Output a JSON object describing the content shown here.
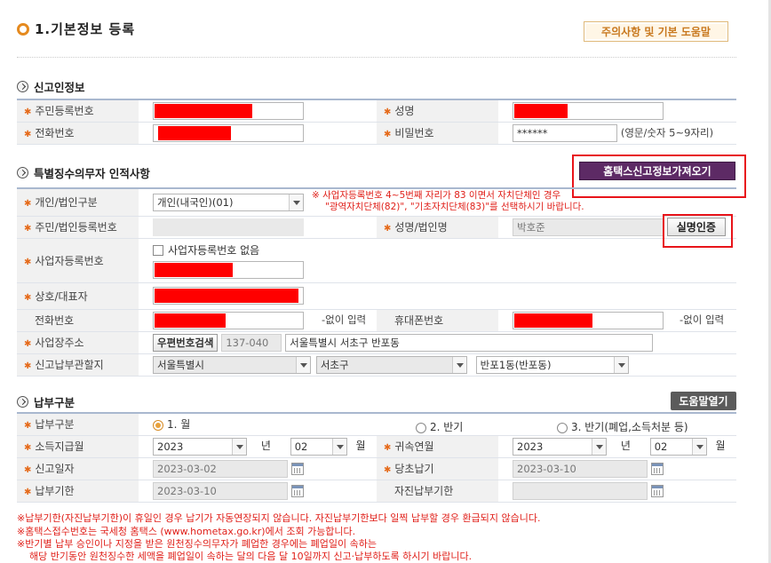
{
  "page": {
    "title": "1.기본정보 등록",
    "help_button": "주의사항 및 기본 도움말"
  },
  "reporter": {
    "section_title": "신고인정보",
    "labels": {
      "rrn": "주민등록번호",
      "name": "성명",
      "phone": "전화번호",
      "password": "비밀번호"
    },
    "password_value": "******",
    "password_hint": "(영문/숫자 5~9자리)"
  },
  "withholder": {
    "section_title": "특별징수의무자 인적사항",
    "hometax_button": "홈택스신고정보가져오기",
    "labels": {
      "type": "개인/법인구분",
      "id_no": "주민/법인등록번호",
      "name": "성명/법인명",
      "biz_no": "사업자등록번호",
      "company": "상호/대표자",
      "phone": "전화번호",
      "mobile": "휴대폰번호",
      "address": "사업장주소",
      "jurisdiction": "신고납부관할지"
    },
    "type_value": "개인(내국인)(01)",
    "notice_line1": "※ 사업자등록번호 4~5번째 자리가 83 이면서 자치단체인 경우",
    "notice_line2": "\"광역자치단체(82)\", \"기초자치단체(83)\"를 선택하시기 바랍니다.",
    "name_value": "박호준",
    "verify_button": "실명인증",
    "no_biz_checkbox": "사업자등록번호 없음",
    "no_input_phone": "-없이 입력",
    "no_input_mobile": "-없이 입력",
    "zip_button": "우편번호검색",
    "zip_value": "137-040",
    "address_value": "서울특별시 서초구 반포동",
    "city_value": "서울특별시",
    "district_value": "서초구",
    "dong_value": "반포1동(반포동)"
  },
  "payment": {
    "section_title": "납부구분",
    "help_button": "도움말열기",
    "labels": {
      "type": "납부구분",
      "pay_month": "소득지급월",
      "attr_month": "귀속연월",
      "report_date": "신고일자",
      "due_date": "당초납기",
      "deadline": "납부기한",
      "self_deadline": "자진납부기한"
    },
    "radio_1": "1. 월",
    "radio_2": "2. 반기",
    "radio_3": "3. 반기(폐업,소득처분 등)",
    "pay_year": "2023",
    "pay_month": "02",
    "attr_year": "2023",
    "attr_month": "02",
    "year_unit": "년",
    "month_unit": "월",
    "report_date_value": "2023-03-02",
    "due_date_value": "2023-03-10",
    "deadline_value": "2023-03-10"
  },
  "footnotes": [
    "※납부기한(자진납부기한)이 휴일인 경우 납기가 자동연장되지 않습니다. 자진납부기한보다 일찍 납부할 경우 환급되지 않습니다.",
    "※홈택스접수번호는 국세청 홈택스 (www.hometax.go.kr)에서 조회 가능합니다.",
    "※반기별 납부 승인이나 지정을 받은 원천징수의무자가 폐업한 경우에는 폐업일이 속하는",
    "해당 반기동안 원천징수한 세액을 폐업일이 속하는 달의 다음 달 10일까지 신고·납부하도록 하시기 바랍니다."
  ],
  "colors": {
    "accent_orange": "#e58a1f",
    "redaction": "#ff0000",
    "purple_button": "#5d2a65",
    "notice_red": "#e0201a"
  }
}
